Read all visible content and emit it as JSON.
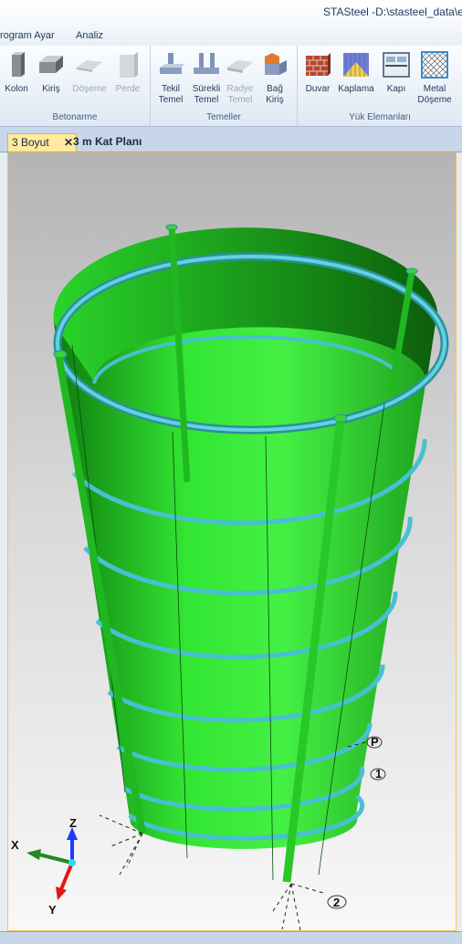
{
  "window": {
    "title": "STASteel -D:\\stasteel_data\\eg"
  },
  "menu": {
    "program_ayar": "rogram Ayar",
    "analiz": "Analiz"
  },
  "ribbon": {
    "betonarme": {
      "label": "Betonarme",
      "kolon": "Kolon",
      "kiris": "Kiriş",
      "doseme": "Döşeme",
      "perde": "Perde"
    },
    "temeller": {
      "label": "Temeller",
      "tekil_1": "Tekil",
      "tekil_2": "Temel",
      "surekli_1": "Sürekli",
      "surekli_2": "Temel",
      "radye_1": "Radye",
      "radye_2": "Temel",
      "bag_1": "Bağ",
      "bag_2": "Kiriş"
    },
    "yuk": {
      "label": "Yük Elemanları",
      "duvar": "Duvar",
      "kaplama": "Kaplama",
      "kapi": "Kapı",
      "metal_1": "Metal",
      "metal_2": "Döşeme"
    }
  },
  "tabs": {
    "tab1": "3 Boyut",
    "tab1_close": "✕",
    "tab2": "3 m Kat Planı"
  },
  "viewport": {
    "axes": {
      "x": "X",
      "y": "Y",
      "z": "Z"
    },
    "gridlabels": {
      "a": "P",
      "b": "1",
      "c": "2"
    }
  },
  "colors": {
    "shell": "#33e633",
    "ring": "#48c0d0",
    "accent": "#f3c64a"
  }
}
